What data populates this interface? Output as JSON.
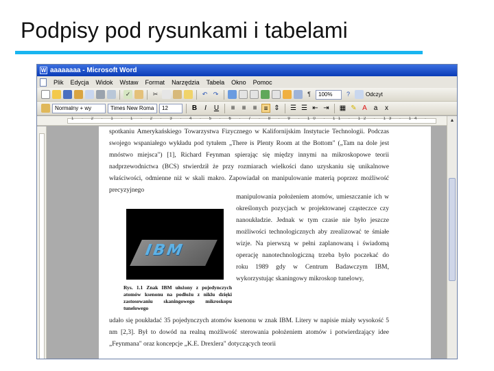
{
  "slide": {
    "title": "Podpisy pod rysunkami i tabelami"
  },
  "window": {
    "title": "aaaaaaaa - Microsoft Word"
  },
  "menu": [
    "Plik",
    "Edycja",
    "Widok",
    "Wstaw",
    "Format",
    "Narzędzia",
    "Tabela",
    "Okno",
    "Pomoc"
  ],
  "toolbar": {
    "zoom": "100%",
    "read_label": "Odczyt",
    "style": "Normalny + wy",
    "font": "Times New Roma",
    "font_size": "12",
    "bold": "B",
    "italic": "I",
    "underline": "U",
    "paragraph_mark": "¶"
  },
  "ruler": {
    "numbers": "1 · 2 · 1 · 1 · 2 · 3 · 4 · 5 · 6 · 7 · 8 · 9 · 10 · 11 · 12 · 13 · 14 · 15 · 16"
  },
  "document": {
    "para1": "spotkaniu Amerykańskiego Towarzystwa Fizycznego w Kalifornijskim Instytucie Technologii. Podczas swojego wspaniałego wykładu pod tytułem „There is Plenty Room at the Bottom\" („Tam na dole jest mnóstwo miejsca\") [1], Richard Feynman spierając się między innymi na mikroskopowe teorii nadprzewodnictwa (BCS) stwierdził że przy rozmiarach wielkości dano uzyskaniu się unikalnowe właściwości, odmienne niż w skali makro. Zapowiadał on manipulowanie materią poprzez możliwość precyzyjnego",
    "para2": "manipulowania położeniem atomów, umieszczanie ich w określonych pozycjach w projektowanej cząsteczce czy nanoukładzie. Jednak w tym czasie nie było jeszcze możliwości technologicznych aby zrealizować te śmiałe wizje. Na pierwszą w pełni zaplanowaną i świadomą operację nanotechnologiczną trzeba było poczekać do roku 1989 gdy w Centrum Badawczym IBM, wykorzystując skaningowy mikroskop tunelowy,",
    "para3": "udało się poukładać 35 pojedynczych atomów ksenonu w znak IBM. Litery w napisie miały wysokość 5 nm [2,3]. Był to dowód na realną możliwość sterowania położeniem atomów i potwierdzający idee „Feynmana\" oraz koncepcje „K.E. Drexlera\" dotyczących teorii",
    "figure_caption": "Rys. 1.1 Znak IBM ułożony z pojedynczych atomów ksenonu na podłożu z niklu dzięki zastosowaniu skaningowego mikroskopu tunelowego",
    "figure_text": "IBM"
  }
}
